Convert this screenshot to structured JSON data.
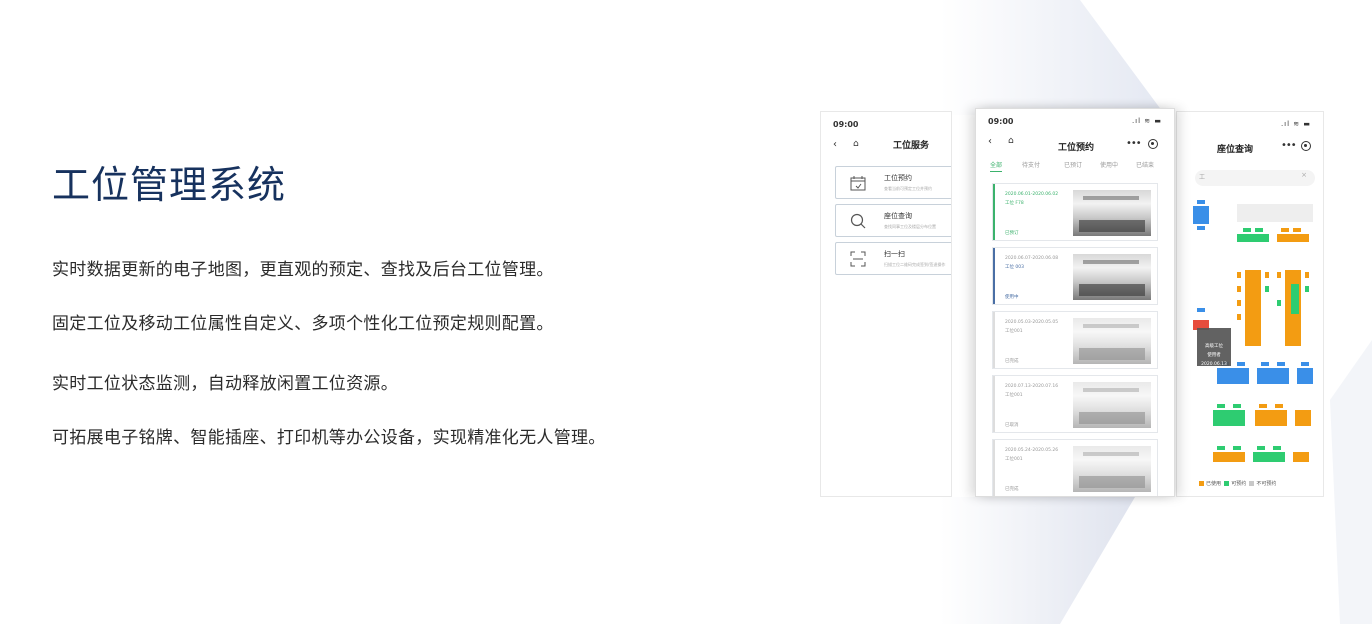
{
  "title": "工位管理系统",
  "paragraphs": [
    "实时数据更新的电子地图，更直观的预定、查找及后台工位管理。",
    "固定工位及移动工位属性自定义、多项个性化工位预定规则配置。",
    "实时工位状态监测，自动释放闲置工位资源。",
    "可拓展电子铭牌、智能插座、打印机等办公设备，实现精准化无人管理。"
  ],
  "phone_left": {
    "time": "09:00",
    "nav_title": "工位服务",
    "services": [
      {
        "label": "工位预约",
        "desc": "查看当前可预定工位并预约",
        "icon": "calendar-icon"
      },
      {
        "label": "座位查询",
        "desc": "查找同事工位及楼层分布位置",
        "icon": "search-icon"
      },
      {
        "label": "扫一扫",
        "desc": "扫描工位二维码完成签到/签退操作",
        "icon": "scan-icon"
      }
    ]
  },
  "phone_middle": {
    "time": "09:00",
    "nav_title": "工位预约",
    "tabs": [
      "全部",
      "待支付",
      "已预订",
      "使用中",
      "已结束"
    ],
    "reservations": [
      {
        "date": "2020.06.01-2020.06.02",
        "seat": "工位 F78",
        "status": "已预订",
        "accent": "#3bb26c"
      },
      {
        "date": "2020.06.07-2020.06.08",
        "seat": "工位 003",
        "status": "使用中",
        "accent": "#4a6fa5"
      },
      {
        "date": "2020.05.03-2020.05.05",
        "seat": "工位001",
        "status": "已完成",
        "accent": "#dddddd"
      },
      {
        "date": "2020.07.13-2020.07.16",
        "seat": "工位001",
        "status": "已取消",
        "accent": "#dddddd"
      },
      {
        "date": "2020.05.24-2020.05.26",
        "seat": "工位001",
        "status": "已完成",
        "accent": "#dddddd"
      }
    ]
  },
  "phone_right": {
    "nav_title": "座位查询",
    "search_placeholder": "工",
    "tooltip_lines": [
      "高级工位",
      "使用者",
      "2020.06.13"
    ],
    "legend": [
      {
        "label": "已使用",
        "color": "#f39c12"
      },
      {
        "label": "可预约",
        "color": "#2ecc71"
      },
      {
        "label": "不可预约",
        "color": "#c8c8c8"
      }
    ]
  },
  "colors": {
    "title": "#17325e",
    "accent_green": "#3bb26c",
    "seat_blue": "#3a8fe8",
    "seat_orange": "#f39c12",
    "seat_green": "#2ecc71",
    "seat_red": "#e74c3c"
  }
}
